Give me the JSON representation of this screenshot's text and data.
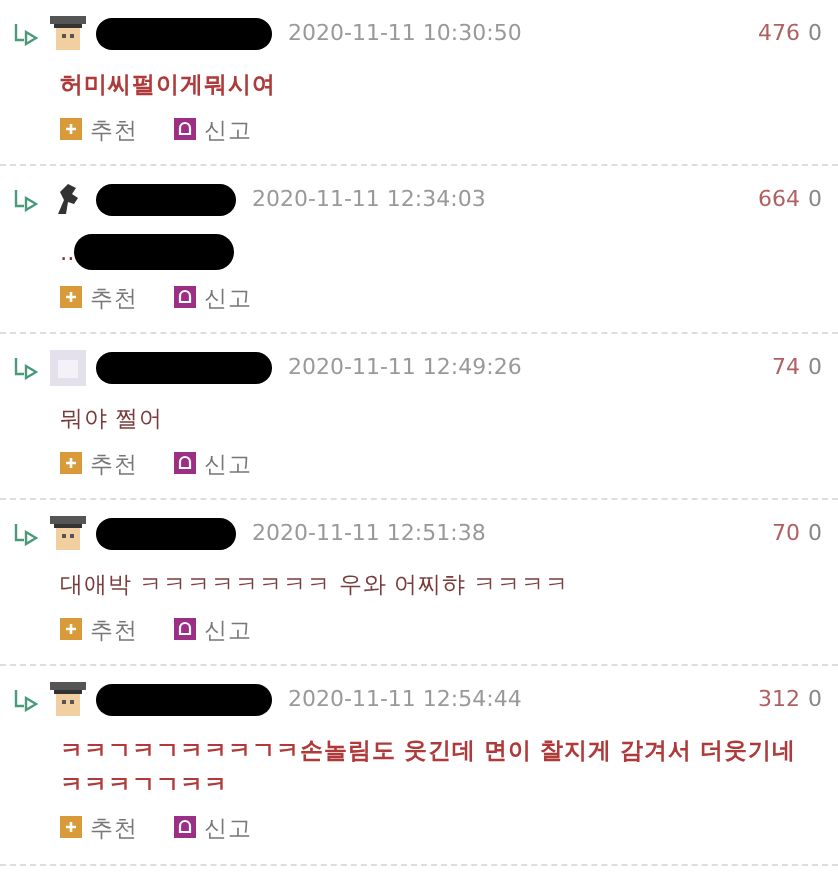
{
  "comments": [
    {
      "avatar": {
        "kind": "graduate"
      },
      "time": "2020-11-11 10:30:50",
      "votes": "476",
      "count": "0",
      "text": "허미씨펄이게뭐시여",
      "bold": true,
      "text_redacted": false,
      "actions": [
        "추천",
        "신고"
      ]
    },
    {
      "avatar": {
        "kind": "horse"
      },
      "time": "2020-11-11 12:34:03",
      "votes": "664",
      "count": "0",
      "text": "..",
      "bold": false,
      "text_redacted": true,
      "actions": [
        "추천",
        "신고"
      ]
    },
    {
      "avatar": {
        "kind": "blank"
      },
      "time": "2020-11-11 12:49:26",
      "votes": "74",
      "count": "0",
      "text": "뭐야 쩔어",
      "bold": false,
      "text_redacted": false,
      "actions": [
        "추천",
        "신고"
      ]
    },
    {
      "avatar": {
        "kind": "graduate"
      },
      "time": "2020-11-11 12:51:38",
      "votes": "70",
      "count": "0",
      "text": "대애박 ㅋㅋㅋㅋㅋㅋㅋㅋ 우와 어찌햐 ㅋㅋㅋㅋ",
      "bold": false,
      "text_redacted": false,
      "actions": [
        "추천",
        "신고"
      ]
    },
    {
      "avatar": {
        "kind": "graduate"
      },
      "time": "2020-11-11 12:54:44",
      "votes": "312",
      "count": "0",
      "text": "ㅋㅋㄱㅋㄱㅋㅋㅋㄱㅋ손놀림도 웃긴데 면이 찰지게 감겨서 더웃기네 ㅋㅋㅋㄱㄱㅋㅋ",
      "bold": true,
      "text_redacted": false,
      "actions": [
        "추천",
        "신고"
      ]
    }
  ]
}
